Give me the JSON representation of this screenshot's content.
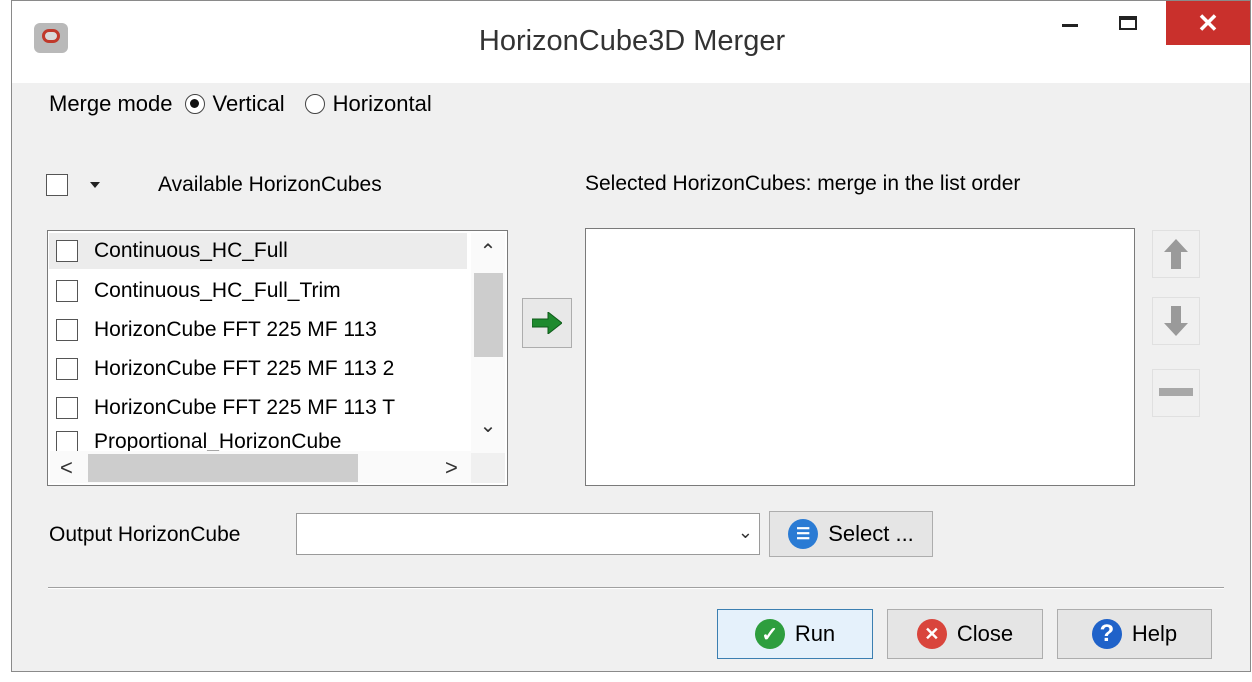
{
  "window": {
    "title": "HorizonCube3D Merger",
    "close_glyph": "✕"
  },
  "merge_mode": {
    "label": "Merge mode",
    "options": [
      "Vertical",
      "Horizontal"
    ],
    "selected": "Vertical"
  },
  "available": {
    "label": "Available HorizonCubes",
    "items": [
      "Continuous_HC_Full",
      "Continuous_HC_Full_Trim",
      "HorizonCube FFT 225 MF 113",
      "HorizonCube FFT 225 MF 113 2",
      "HorizonCube FFT 225 MF 113 T",
      "Proportional_HorizonCube"
    ]
  },
  "selected": {
    "label": "Selected HorizonCubes: merge in the list order",
    "items": []
  },
  "output": {
    "label": "Output HorizonCube",
    "value": "",
    "select_label": "Select ..."
  },
  "buttons": {
    "run": "Run",
    "close": "Close",
    "help": "Help"
  },
  "colors": {
    "close_red": "#c9302c",
    "run_green": "#2e9e3e",
    "help_blue": "#1f62c9",
    "select_blue": "#2a7bd4",
    "arrow_green": "#1e8a2e"
  },
  "icons": {
    "scroll_up": "⌃",
    "scroll_down": "⌄",
    "scroll_left": "<",
    "scroll_right": ">",
    "combo_chevron": "⌄",
    "run": "✓",
    "close": "✕",
    "help": "?"
  }
}
